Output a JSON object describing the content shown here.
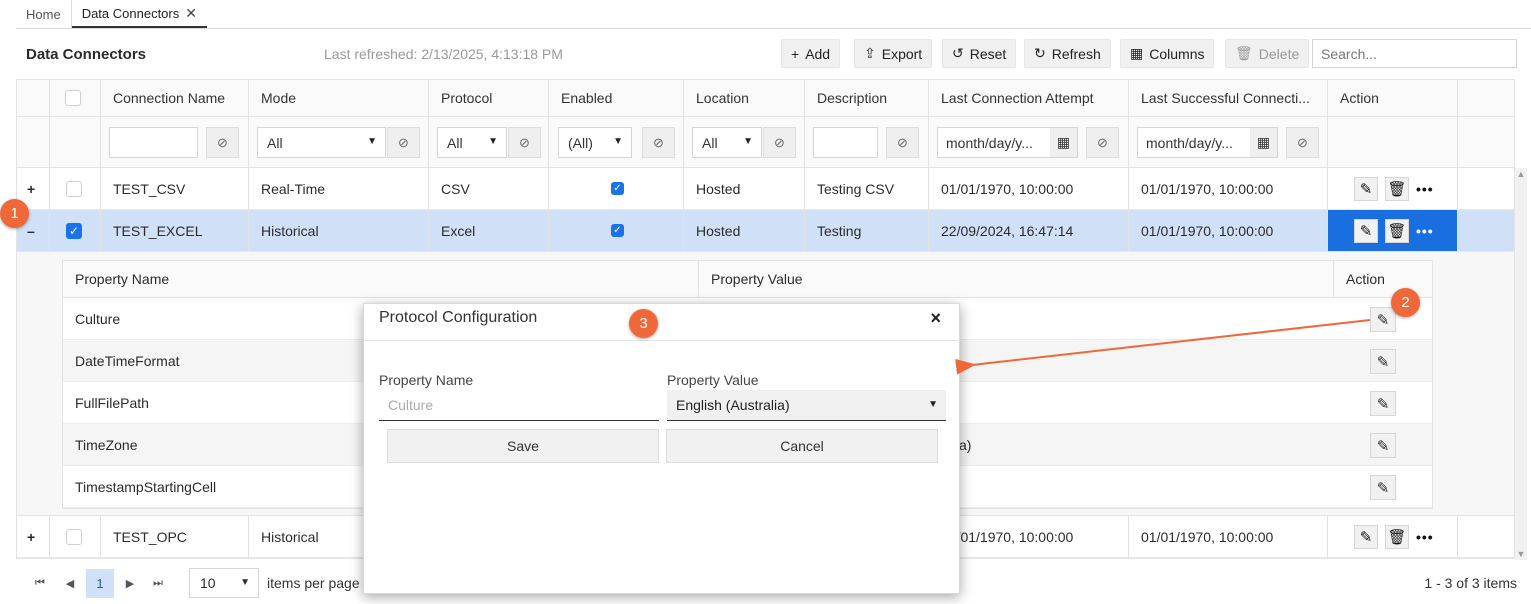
{
  "tabs": [
    {
      "label": "Home"
    },
    {
      "label": "Data Connectors",
      "close": "✕"
    }
  ],
  "toolbar": {
    "title": "Data Connectors",
    "last_refreshed": "Last refreshed: 2/13/2025, 4:13:18 PM",
    "add": "Add",
    "export": "Export",
    "reset": "Reset",
    "refresh": "Refresh",
    "columns": "Columns",
    "delete": "Delete",
    "search_placeholder": "Search..."
  },
  "grid": {
    "headers": [
      "Connection Name",
      "Mode",
      "Protocol",
      "Enabled",
      "Location",
      "Description",
      "Last Connection Attempt",
      "Last Successful Connecti...",
      "Action"
    ],
    "filters": {
      "mode": "All",
      "protocol": "All",
      "enabled": "(All)",
      "location": "All",
      "date_placeholder_1": "month/day/y...",
      "date_placeholder_2": "month/day/y..."
    },
    "rows": [
      {
        "expander": "+",
        "name": "TEST_CSV",
        "mode": "Real-Time",
        "protocol": "CSV",
        "location": "Hosted",
        "description": "Testing CSV",
        "last_attempt": "01/01/1970, 10:00:00",
        "last_success": "01/01/1970, 10:00:00"
      },
      {
        "expander": "–",
        "name": "TEST_EXCEL",
        "mode": "Historical",
        "protocol": "Excel",
        "location": "Hosted",
        "description": "Testing",
        "last_attempt": "22/09/2024, 16:47:14",
        "last_success": "01/01/1970, 10:00:00"
      },
      {
        "expander": "+",
        "name": "TEST_OPC",
        "mode": "Historical",
        "last_attempt_partial": "01/01/1970, 10:00:00",
        "last_success": "01/01/1970, 10:00:00"
      }
    ]
  },
  "detail": {
    "headers": [
      "Property Name",
      "Property Value",
      "Action"
    ],
    "rows": [
      {
        "name": "Culture"
      },
      {
        "name": "DateTimeFormat"
      },
      {
        "name": "FullFilePath"
      },
      {
        "name": "TimeZone",
        "value_partial": "a)"
      },
      {
        "name": "TimestampStartingCell"
      }
    ]
  },
  "modal": {
    "title": "Protocol Configuration",
    "close": "×",
    "property_name_label": "Property Name",
    "property_name_placeholder": "Culture",
    "property_value_label": "Property Value",
    "property_value": "English (Australia)",
    "save": "Save",
    "cancel": "Cancel"
  },
  "pager": {
    "current_page": "1",
    "page_size": "10",
    "per_page_label": "items per page",
    "count": "1 - 3 of 3 items"
  },
  "badges": [
    "1",
    "2",
    "3"
  ],
  "colors": {
    "accent": "#1a73e8",
    "selected_row": "#cfe0f7",
    "badge": "#f0683a",
    "action_highlight": "#1a6fe0"
  }
}
